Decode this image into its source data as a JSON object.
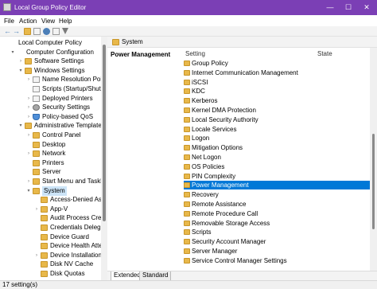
{
  "window": {
    "title": "Local Group Policy Editor",
    "controls": {
      "minimize": "—",
      "maximize": "☐",
      "close": "✕"
    }
  },
  "menu": [
    "File",
    "Action",
    "View",
    "Help"
  ],
  "toolbar": {
    "icons": [
      "back-icon",
      "forward-icon",
      "folder-icon",
      "properties-icon",
      "help-icon",
      "view-icon",
      "filter-icon"
    ]
  },
  "tree": [
    {
      "label": "Local Computer Policy",
      "indent": 0,
      "icon": "computer",
      "twisty": ""
    },
    {
      "label": "Computer Configuration",
      "indent": 1,
      "icon": "computer",
      "twisty": "▾"
    },
    {
      "label": "Software Settings",
      "indent": 2,
      "icon": "folder",
      "twisty": "›"
    },
    {
      "label": "Windows Settings",
      "indent": 2,
      "icon": "folder",
      "twisty": "▾"
    },
    {
      "label": "Name Resolution Policy",
      "indent": 3,
      "icon": "doc",
      "twisty": "›"
    },
    {
      "label": "Scripts (Startup/Shutdow",
      "indent": 3,
      "icon": "doc",
      "twisty": ""
    },
    {
      "label": "Deployed Printers",
      "indent": 3,
      "icon": "doc",
      "twisty": "›"
    },
    {
      "label": "Security Settings",
      "indent": 3,
      "icon": "gear",
      "twisty": "›"
    },
    {
      "label": "Policy-based QoS",
      "indent": 3,
      "icon": "shield",
      "twisty": "›"
    },
    {
      "label": "Administrative Templates",
      "indent": 2,
      "icon": "folder",
      "twisty": "▾"
    },
    {
      "label": "Control Panel",
      "indent": 3,
      "icon": "folder",
      "twisty": "›"
    },
    {
      "label": "Desktop",
      "indent": 3,
      "icon": "folder",
      "twisty": ""
    },
    {
      "label": "Network",
      "indent": 3,
      "icon": "folder",
      "twisty": "›"
    },
    {
      "label": "Printers",
      "indent": 3,
      "icon": "folder",
      "twisty": ""
    },
    {
      "label": "Server",
      "indent": 3,
      "icon": "folder",
      "twisty": ""
    },
    {
      "label": "Start Menu and Taskbar",
      "indent": 3,
      "icon": "folder",
      "twisty": "›"
    },
    {
      "label": "System",
      "indent": 3,
      "icon": "folder",
      "twisty": "▾",
      "selected": true
    },
    {
      "label": "Access-Denied Assist",
      "indent": 4,
      "icon": "folder",
      "twisty": ""
    },
    {
      "label": "App-V",
      "indent": 4,
      "icon": "folder",
      "twisty": "›"
    },
    {
      "label": "Audit Process Creatio",
      "indent": 4,
      "icon": "folder",
      "twisty": ""
    },
    {
      "label": "Credentials Delegatio",
      "indent": 4,
      "icon": "folder",
      "twisty": ""
    },
    {
      "label": "Device Guard",
      "indent": 4,
      "icon": "folder",
      "twisty": ""
    },
    {
      "label": "Device Health Attesta",
      "indent": 4,
      "icon": "folder",
      "twisty": ""
    },
    {
      "label": "Device Installation",
      "indent": 4,
      "icon": "folder",
      "twisty": "›"
    },
    {
      "label": "Disk NV Cache",
      "indent": 4,
      "icon": "folder",
      "twisty": ""
    },
    {
      "label": "Disk Quotas",
      "indent": 4,
      "icon": "folder",
      "twisty": ""
    }
  ],
  "right_pane": {
    "path": "System",
    "description_title": "Power Management",
    "columns": {
      "setting": "Setting",
      "state": "State"
    },
    "rows": [
      {
        "label": "Group Policy"
      },
      {
        "label": "Internet Communication Management"
      },
      {
        "label": "iSCSI"
      },
      {
        "label": "KDC"
      },
      {
        "label": "Kerberos"
      },
      {
        "label": "Kernel DMA Protection"
      },
      {
        "label": "Local Security Authority"
      },
      {
        "label": "Locale Services"
      },
      {
        "label": "Logon"
      },
      {
        "label": "Mitigation Options"
      },
      {
        "label": "Net Logon"
      },
      {
        "label": "OS Policies"
      },
      {
        "label": "PIN Complexity"
      },
      {
        "label": "Power Management",
        "selected": true
      },
      {
        "label": "Recovery"
      },
      {
        "label": "Remote Assistance"
      },
      {
        "label": "Remote Procedure Call"
      },
      {
        "label": "Removable Storage Access"
      },
      {
        "label": "Scripts"
      },
      {
        "label": "Security Account Manager"
      },
      {
        "label": "Server Manager"
      },
      {
        "label": "Service Control Manager Settings"
      }
    ]
  },
  "tabs": [
    "Extended",
    "Standard"
  ],
  "status": "17 setting(s)",
  "colors": {
    "titlebar": "#7b3fb5",
    "selection": "#0078d7",
    "folder": "#e8b84a"
  }
}
